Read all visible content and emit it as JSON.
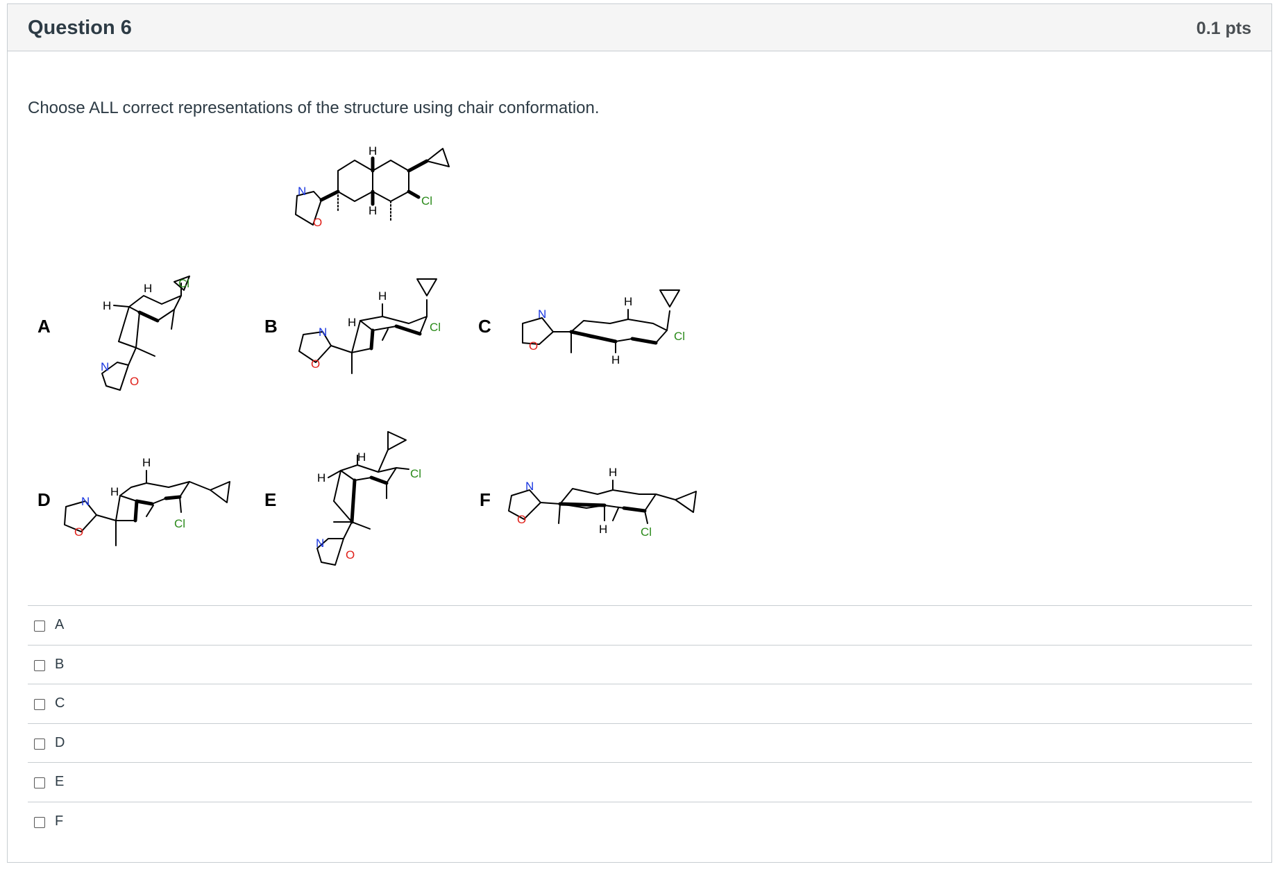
{
  "question": {
    "title": "Question 6",
    "points": "0.1 pts",
    "text": "Choose ALL correct representations of the structure using chair conformation."
  },
  "option_labels": [
    "A",
    "B",
    "C",
    "D",
    "E",
    "F"
  ],
  "answers": [
    {
      "label": "A",
      "checked": false
    },
    {
      "label": "B",
      "checked": false
    },
    {
      "label": "C",
      "checked": false
    },
    {
      "label": "D",
      "checked": false
    },
    {
      "label": "E",
      "checked": false
    },
    {
      "label": "F",
      "checked": false
    }
  ],
  "atom_labels": {
    "H": "H",
    "N": "N",
    "O": "O",
    "Cl": "Cl"
  },
  "colors": {
    "nitrogen": "#1a37e0",
    "oxygen": "#e0201a",
    "chlorine": "#2a8a1a",
    "bond": "#000000"
  }
}
